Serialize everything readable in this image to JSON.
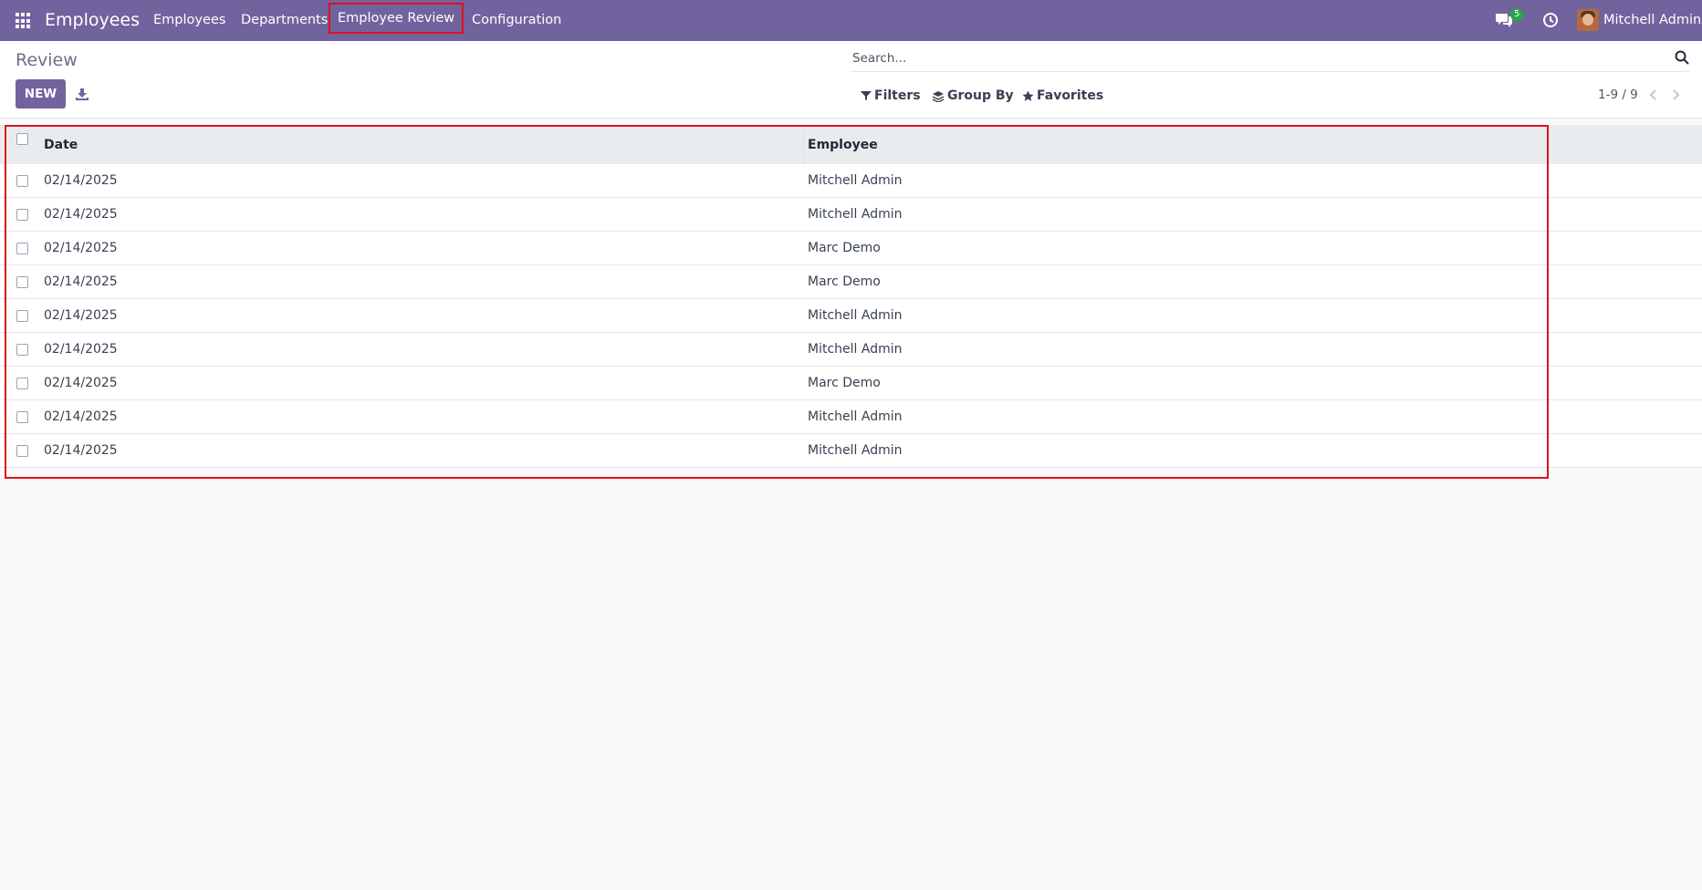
{
  "navbar": {
    "brand": "Employees",
    "menu": [
      {
        "label": "Employees"
      },
      {
        "label": "Departments"
      },
      {
        "label": "Employee Review"
      },
      {
        "label": "Configuration"
      }
    ],
    "messages_count": "5",
    "user_name": "Mitchell Admin"
  },
  "control_panel": {
    "title": "Review",
    "new_label": "NEW",
    "search_placeholder": "Search...",
    "filters_label": "Filters",
    "group_by_label": "Group By",
    "favorites_label": "Favorites",
    "pager": "1-9 / 9"
  },
  "table": {
    "columns": [
      "Date",
      "Employee"
    ],
    "rows": [
      {
        "date": "02/14/2025",
        "employee": "Mitchell Admin"
      },
      {
        "date": "02/14/2025",
        "employee": "Mitchell Admin"
      },
      {
        "date": "02/14/2025",
        "employee": "Marc Demo"
      },
      {
        "date": "02/14/2025",
        "employee": "Marc Demo"
      },
      {
        "date": "02/14/2025",
        "employee": "Mitchell Admin"
      },
      {
        "date": "02/14/2025",
        "employee": "Mitchell Admin"
      },
      {
        "date": "02/14/2025",
        "employee": "Marc Demo"
      },
      {
        "date": "02/14/2025",
        "employee": "Mitchell Admin"
      },
      {
        "date": "02/14/2025",
        "employee": "Mitchell Admin"
      }
    ]
  },
  "colors": {
    "brand": "#71639e",
    "highlight": "#e0101e",
    "badge": "#28a745"
  },
  "icons": [
    "apps-grid-icon",
    "chat-icon",
    "clock-icon",
    "download-icon",
    "search-icon",
    "filter-icon",
    "layers-icon",
    "star-icon",
    "chevron-left-icon",
    "chevron-right-icon"
  ]
}
